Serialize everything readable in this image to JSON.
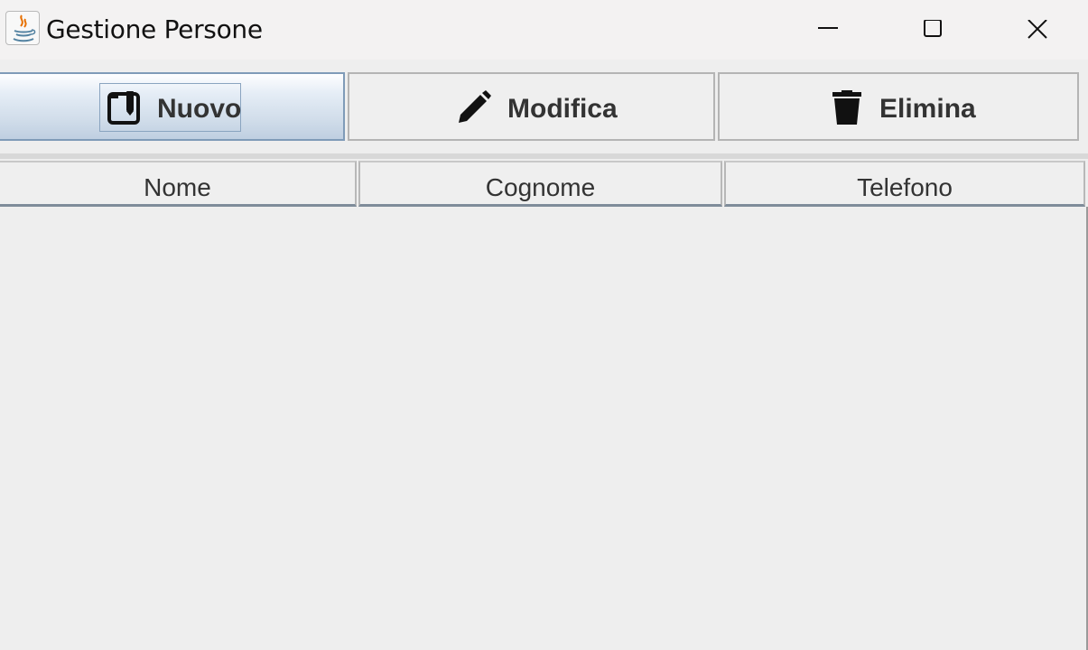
{
  "window": {
    "title": "Gestione Persone",
    "icon": "java-icon",
    "controls": [
      "minimize-icon",
      "maximize-icon",
      "close-icon"
    ]
  },
  "toolbar": {
    "buttons": [
      {
        "label": "Nuovo",
        "icon": "new-document-icon",
        "state": "focused"
      },
      {
        "label": "Modifica",
        "icon": "pencil-icon"
      },
      {
        "label": "Elimina",
        "icon": "trash-icon"
      }
    ]
  },
  "table": {
    "columns": [
      "Nome",
      "Cognome",
      "Telefono"
    ],
    "rows": []
  },
  "colors": {
    "background": "#eeeeee",
    "active_button_top": "#fefeff",
    "active_button_bottom": "#bfcfe1",
    "header_border": "#7f8c9a"
  }
}
